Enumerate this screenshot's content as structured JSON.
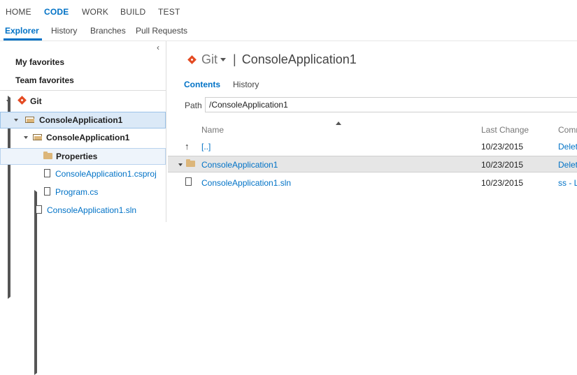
{
  "top_nav": [
    "HOME",
    "CODE",
    "WORK",
    "BUILD",
    "TEST"
  ],
  "sub_nav": [
    "Explorer",
    "History",
    "Branches",
    "Pull Requests"
  ],
  "left_tree": {
    "collapse_glyph": "‹",
    "my_favorites": "My favorites",
    "team_favorites": "Team favorites",
    "git": "Git",
    "repo": "ConsoleApplication1",
    "project_folder": "ConsoleApplication1",
    "properties": "Properties",
    "csproj": "ConsoleApplication1.csproj",
    "program": "Program.cs",
    "sln": "ConsoleApplication1.sln"
  },
  "content": {
    "title_git": "Git",
    "title_sep": "|",
    "title_repo": "ConsoleApplication1",
    "tabs": [
      "Contents",
      "History"
    ],
    "path_label": "Path",
    "path_value": "/ConsoleApplication1",
    "columns": {
      "name": "Name",
      "last_change": "Last Change",
      "comment": "Comm"
    },
    "rows": [
      {
        "icon": "up-arrow-icon",
        "name": "[..]",
        "date": "10/23/2015",
        "comment": "Delet"
      },
      {
        "icon": "folder-icon",
        "name": "ConsoleApplication1",
        "date": "10/23/2015",
        "comment": "Delet"
      },
      {
        "icon": "file-icon",
        "name": "ConsoleApplication1.sln",
        "date": "10/23/2015",
        "comment": "ss - L"
      }
    ]
  },
  "colors": {
    "accent": "#0072c6",
    "selected_bg": "#dbe9f7",
    "git_red": "#e44b23",
    "folder": "#dcb67a"
  }
}
